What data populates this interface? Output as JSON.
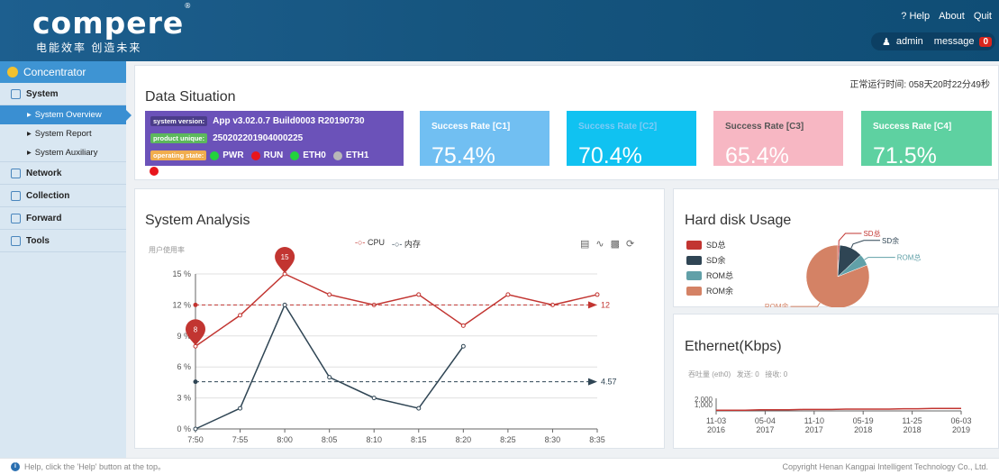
{
  "brand": {
    "logo": "compere",
    "registered": "®",
    "slogan": "电能效率 创造未来"
  },
  "toplinks": {
    "help": "Help",
    "about": "About",
    "quit": "Quit"
  },
  "user": {
    "name": "admin",
    "message_label": "message",
    "message_count": "0"
  },
  "sidebar": {
    "header": "Concentrator",
    "groups": [
      {
        "label": "System",
        "items": [
          "System Overview",
          "System Report",
          "System Auxiliary"
        ]
      },
      {
        "label": "Network"
      },
      {
        "label": "Collection"
      },
      {
        "label": "Forward"
      },
      {
        "label": "Tools"
      }
    ],
    "active_item": "System Overview"
  },
  "uptime": "正常运行时间: 058天20时22分49秒",
  "data_situation": {
    "title": "Data Situation",
    "system_version_label": "system version:",
    "system_version": "App v3.02.0.7 Build0003 R20190730",
    "product_unique_label": "product unique:",
    "product_unique": "250202201904000225",
    "operating_state_label": "operating state:",
    "states": [
      {
        "name": "PWR",
        "color": "#22d33c"
      },
      {
        "name": "RUN",
        "color": "#e8161c"
      },
      {
        "name": "ETH0",
        "color": "#22d33c"
      },
      {
        "name": "ETH1",
        "color": "#b8b8b8"
      }
    ],
    "rates": [
      {
        "label": "Success Rate [C1]",
        "value": "75.4%",
        "color": "#71bff2"
      },
      {
        "label": "Success Rate [C2]",
        "value": "70.4%",
        "color": "#10c2f1"
      },
      {
        "label": "Success Rate [C3]",
        "value": "65.4%",
        "color": "#f7b7c3"
      },
      {
        "label": "Success Rate [C4]",
        "value": "71.5%",
        "color": "#5ed1a1"
      }
    ]
  },
  "system_analysis": {
    "title": "System Analysis",
    "ylabel": "用户使用率",
    "legend": [
      "CPU",
      "内存"
    ],
    "toolbox": [
      "data-view-icon",
      "line-icon",
      "bar-icon",
      "refresh-icon"
    ]
  },
  "hard_disk": {
    "title": "Hard disk Usage",
    "legend": [
      "SD总",
      "SD余",
      "ROM总",
      "ROM余"
    ],
    "colors": [
      "#c23531",
      "#2f4554",
      "#61a0a8",
      "#d48265"
    ]
  },
  "ethernet": {
    "title": "Ethernet(Kbps)",
    "subtitle": "吞吐量 (eth0)   发送: 0   接收: 0",
    "y_labels": [
      "2,000",
      "1,000"
    ],
    "x_labels": [
      "11-03\n2016",
      "05-04\n2017",
      "11-10\n2017",
      "05-19\n2018",
      "11-25\n2018",
      "06-03\n2019"
    ]
  },
  "footer": {
    "help_text": "Help, click the 'Help' button at the top。",
    "copyright": "Copyright Henan Kangpai Intelligent Technology Co., Ltd."
  },
  "chart_data": [
    {
      "type": "line",
      "title": "System Analysis",
      "ylabel": "用户使用率",
      "categories": [
        "7:50",
        "7:55",
        "8:00",
        "8:05",
        "8:10",
        "8:15",
        "8:20",
        "8:25",
        "8:30",
        "8:35"
      ],
      "y_ticks": [
        "0 %",
        "3 %",
        "6 %",
        "9 %",
        "12 %",
        "15 %"
      ],
      "ylim": [
        0,
        15
      ],
      "series": [
        {
          "name": "CPU",
          "color": "#c23531",
          "values": [
            8,
            11,
            15,
            13,
            12,
            13,
            10,
            13,
            12,
            13
          ],
          "mark_line": 12,
          "max_point": 15,
          "min_point": 8
        },
        {
          "name": "内存",
          "color": "#2f4554",
          "values": [
            0,
            2,
            12,
            5,
            3,
            2,
            8,
            null,
            null,
            null
          ],
          "mark_line": 4.57
        }
      ],
      "grid": true,
      "legend": "top-center"
    },
    {
      "type": "pie",
      "title": "Hard disk Usage",
      "labels": [
        "SD总",
        "SD余",
        "ROM总",
        "ROM余"
      ],
      "values": [
        1,
        12,
        6,
        81
      ],
      "legend": "left"
    },
    {
      "type": "line",
      "title": "Ethernet(Kbps)",
      "series": [
        {
          "name": "吞吐量 (eth0)",
          "color": "#c23531",
          "values": [
            2,
            2,
            2,
            3,
            3,
            3,
            4,
            4,
            4,
            5,
            5,
            5,
            5,
            6,
            6,
            7,
            7,
            7
          ]
        }
      ]
    }
  ]
}
